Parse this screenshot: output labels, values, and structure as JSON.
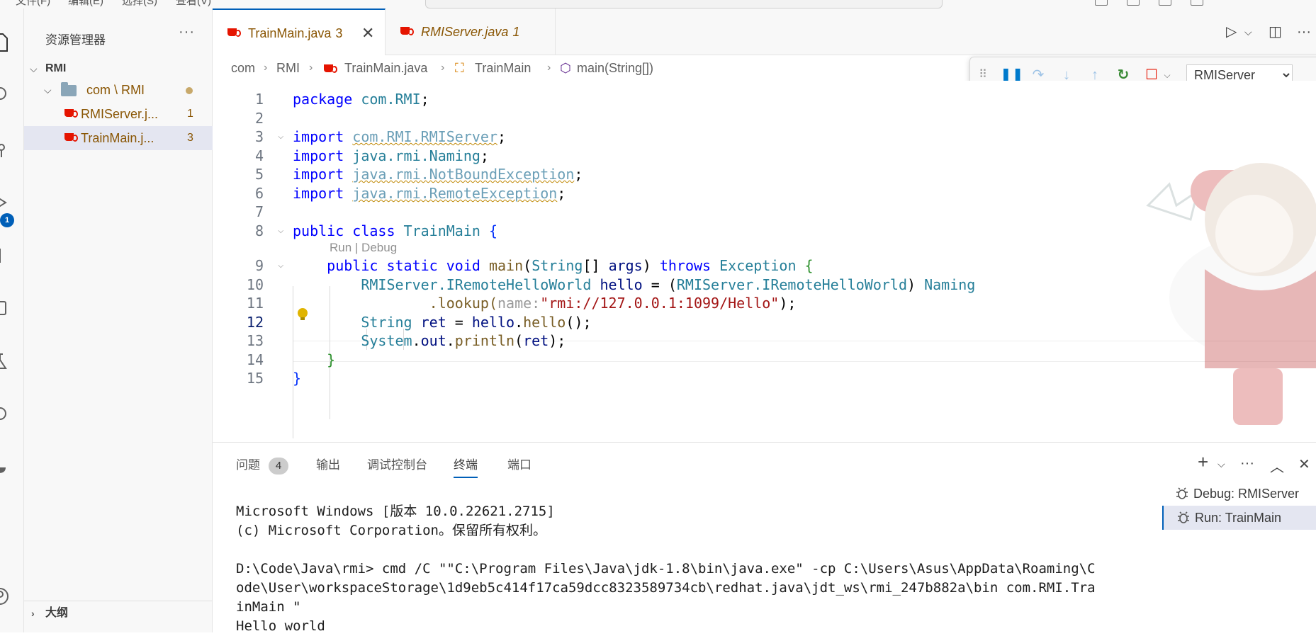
{
  "menubar": {
    "items": [
      "文件(F)",
      "编辑(E)",
      "选择(S)",
      "查看(V)"
    ]
  },
  "explorer": {
    "title": "资源管理器",
    "more": "···",
    "root": "RMI",
    "folder": "com \\ RMI",
    "files": [
      {
        "name": "RMIServer.j...",
        "problems": "1"
      },
      {
        "name": "TrainMain.j...",
        "problems": "3"
      }
    ],
    "outline": "大纲"
  },
  "activity": {
    "debug_badge": "1"
  },
  "tabs": [
    {
      "label": "TrainMain.java",
      "problems": "3",
      "active": true
    },
    {
      "label": "RMIServer.java",
      "problems": "1",
      "active": false
    }
  ],
  "breadcrumb": [
    "com",
    "RMI",
    "TrainMain.java",
    "TrainMain",
    "main(String[])"
  ],
  "debug_toolbar": {
    "config": "RMIServer"
  },
  "code": {
    "line_numbers": [
      "1",
      "2",
      "3",
      "4",
      "5",
      "6",
      "7",
      "8",
      "9",
      "10",
      "11",
      "12",
      "13",
      "14",
      "15"
    ],
    "codelens": "Run | Debug",
    "lines": {
      "l1_kw": "package",
      "l1_rest": "com.RMI",
      "import_kw": "import",
      "l3": "com.RMI.RMIServer",
      "l4": "java.rmi.Naming",
      "l5": "java.rmi.NotBoundException",
      "l6": "java.rmi.RemoteException",
      "l8_kw": "public class",
      "l8_name": "TrainMain",
      "l9_kw": "public static void",
      "l9_fn": "main",
      "l9_ty": "String",
      "l9_arg": "args",
      "l9_throws": "throws",
      "l9_ex": "Exception",
      "l10_a": "RMIServer.IRemoteHelloWorld",
      "l10_var": "hello",
      "l10_b": "RMIServer.IRemoteHelloWorld",
      "l10_c": "Naming",
      "l11_fn": ".lookup(",
      "l11_hint": "name:",
      "l11_str": "\"rmi://127.0.0.1:1099/Hello\"",
      "l12_ty": "String",
      "l12_var": "ret",
      "l12_obj": "hello",
      "l12_fn": "hello",
      "l13_ty": "System",
      "l13_out": "out",
      "l13_fn": "println",
      "l13_arg": "ret"
    }
  },
  "panel": {
    "tabs": [
      {
        "label": "问题",
        "badge": "4"
      },
      {
        "label": "输出"
      },
      {
        "label": "调试控制台"
      },
      {
        "label": "终端",
        "active": true
      },
      {
        "label": "端口"
      }
    ],
    "terminal_lines": [
      "Microsoft Windows [版本 10.0.22621.2715]",
      "(c) Microsoft Corporation。保留所有权利。",
      "",
      "D:\\Code\\Java\\rmi> cmd /C \"\"C:\\Program Files\\Java\\jdk-1.8\\bin\\java.exe\" -cp C:\\Users\\Asus\\AppData\\Roaming\\C",
      "ode\\User\\workspaceStorage\\1d9eb5c414f17ca59dcc8323589734cb\\redhat.java\\jdt_ws\\rmi_247b882a\\bin com.RMI.Tra",
      "inMain \"",
      "Hello world"
    ],
    "terminals": [
      "Debug: RMIServer",
      "Run: TrainMain"
    ]
  }
}
